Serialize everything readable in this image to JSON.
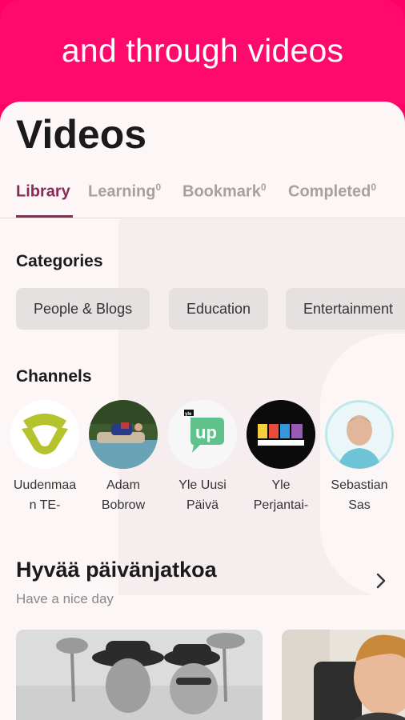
{
  "banner": {
    "text": "and through videos"
  },
  "page": {
    "title": "Videos"
  },
  "tabs": [
    {
      "label": "Library",
      "count": ""
    },
    {
      "label": "Learning",
      "count": "0"
    },
    {
      "label": "Bookmark",
      "count": "0"
    },
    {
      "label": "Completed",
      "count": "0"
    }
  ],
  "categories": {
    "heading": "Categories",
    "items": [
      "People & Blogs",
      "Education",
      "Entertainment"
    ]
  },
  "channels": {
    "heading": "Channels",
    "items": [
      {
        "line1": "Uudenmaa",
        "line2": "n TE-"
      },
      {
        "line1": "Adam",
        "line2": "Bobrow"
      },
      {
        "line1": "Yle Uusi",
        "line2": "Päivä"
      },
      {
        "line1": "Yle",
        "line2": "Perjantai-"
      },
      {
        "line1": "Sebastian",
        "line2": "Sas"
      }
    ]
  },
  "row": {
    "title": "Hyvää päivänjatkoa",
    "subtitle": "Have a nice day"
  },
  "colors": {
    "brand_pink": "#ff0a6c",
    "active_tab": "#8a2a55",
    "inactive_tab": "#a6a0a0"
  }
}
